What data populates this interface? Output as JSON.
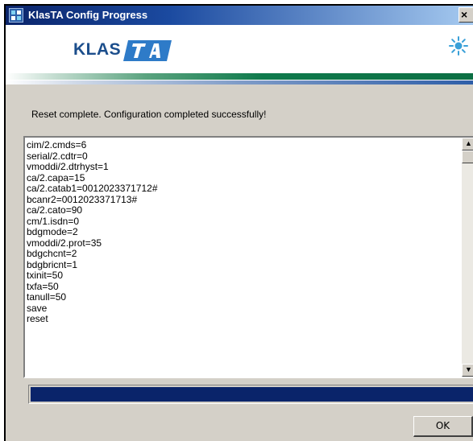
{
  "window": {
    "title": "KlasTA Config Progress",
    "close_glyph": "×"
  },
  "banner": {
    "logo_text": "KLAS",
    "logo_mark": "TA",
    "brand_color": "#1c4e8c",
    "accent_stripe_color": "#0c6f44",
    "icon": "sun-icon"
  },
  "status_message": "Reset complete. Configuration completed successfully!",
  "log": {
    "lines": [
      "cim/2.cmds=6",
      "serial/2.cdtr=0",
      "vmoddi/2.dtrhyst=1",
      "ca/2.capa=15",
      "ca/2.catab1=0012023371712#",
      "bcanr2=0012023371713#",
      "ca/2.cato=90",
      "cm/1.isdn=0",
      "bdgmode=2",
      "vmoddi/2.prot=35",
      "bdgchcnt=2",
      "bdgbricnt=1",
      "txinit=50",
      "txfa=50",
      "tanull=50",
      "save",
      "reset"
    ]
  },
  "progress": {
    "value_fraction": 1.0,
    "fill_color": "#0a246a"
  },
  "buttons": {
    "ok_label": "OK"
  }
}
